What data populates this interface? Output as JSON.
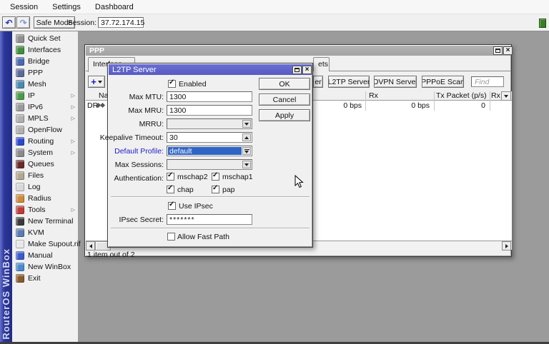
{
  "menubar": {
    "items": [
      "Session",
      "Settings",
      "Dashboard"
    ]
  },
  "toolbar": {
    "safe_mode_label": "Safe Mode",
    "session_label": "Session:",
    "session_value": "37.72.174.15"
  },
  "sidebar": {
    "brand": "RouterOS WinBox",
    "items": [
      {
        "slug": "quick-set",
        "label": "Quick Set",
        "color": "#8f8f8f",
        "arrow": false
      },
      {
        "slug": "interfaces",
        "label": "Interfaces",
        "color": "#3f8f3f",
        "arrow": false
      },
      {
        "slug": "bridge",
        "label": "Bridge",
        "color": "#4a6ab0",
        "arrow": false
      },
      {
        "slug": "ppp",
        "label": "PPP",
        "color": "#5a6a9a",
        "arrow": false
      },
      {
        "slug": "mesh",
        "label": "Mesh",
        "color": "#4a8ab0",
        "arrow": false
      },
      {
        "slug": "ip",
        "label": "IP",
        "color": "#4a9a4a",
        "arrow": true
      },
      {
        "slug": "ipv6",
        "label": "IPv6",
        "color": "#9a9a9a",
        "arrow": true
      },
      {
        "slug": "mpls",
        "label": "MPLS",
        "color": "#b0b0b0",
        "arrow": true
      },
      {
        "slug": "openflow",
        "label": "OpenFlow",
        "color": "#b0b0b0",
        "arrow": false
      },
      {
        "slug": "routing",
        "label": "Routing",
        "color": "#2a4ad0",
        "arrow": true
      },
      {
        "slug": "system",
        "label": "System",
        "color": "#8a8a8a",
        "arrow": true
      },
      {
        "slug": "queues",
        "label": "Queues",
        "color": "#6a2a2a",
        "arrow": false
      },
      {
        "slug": "files",
        "label": "Files",
        "color": "#b0a890",
        "arrow": false
      },
      {
        "slug": "log",
        "label": "Log",
        "color": "#d8d8d8",
        "arrow": false
      },
      {
        "slug": "radius",
        "label": "Radius",
        "color": "#d08a3a",
        "arrow": false
      },
      {
        "slug": "tools",
        "label": "Tools",
        "color": "#c03a3a",
        "arrow": true
      },
      {
        "slug": "new-terminal",
        "label": "New Terminal",
        "color": "#3a3a3a",
        "arrow": false
      },
      {
        "slug": "kvm",
        "label": "KVM",
        "color": "#5a7ab0",
        "arrow": false
      },
      {
        "slug": "make-supout-rif",
        "label": "Make Supout.rif",
        "color": "#e8e8e8",
        "arrow": false
      },
      {
        "slug": "manual",
        "label": "Manual",
        "color": "#3a5ad0",
        "arrow": false
      },
      {
        "slug": "new-winbox",
        "label": "New WinBox",
        "color": "#4a8ad0",
        "arrow": false
      },
      {
        "slug": "exit",
        "label": "Exit",
        "color": "#8a5a2a",
        "arrow": false
      }
    ]
  },
  "ppp": {
    "title": "PPP",
    "tab_interface": "Interface",
    "tab_right_partial": "ets",
    "button_partial": "er",
    "server_buttons": [
      "L2TP Server",
      "OVPN Server",
      "PPPoE Scan"
    ],
    "find_placeholder": "Find",
    "columns": {
      "name_partial": "Na",
      "rx": "Rx",
      "tx_packet": "Tx Packet (p/s)",
      "rx_p_partial": "Rx P"
    },
    "row": {
      "flags": "DR",
      "tx_value": "0 bps",
      "rx_value": "0 bps",
      "tx_packet_value": "0"
    },
    "status": "1 item out of 2"
  },
  "dialog": {
    "title": "L2TP Server",
    "enabled_label": "Enabled",
    "enabled_checked": true,
    "fields": {
      "max_mtu": {
        "label": "Max MTU:",
        "value": "1300"
      },
      "max_mru": {
        "label": "Max MRU:",
        "value": "1300"
      },
      "mrru": {
        "label": "MRRU:",
        "value": ""
      },
      "keepalive": {
        "label": "Keepalive Timeout:",
        "value": "30"
      },
      "default_profile": {
        "label": "Default Profile:",
        "value": "default"
      },
      "max_sessions": {
        "label": "Max Sessions:",
        "value": ""
      }
    },
    "auth": {
      "label": "Authentication:",
      "options": [
        {
          "label": "mschap2",
          "checked": true
        },
        {
          "label": "mschap1",
          "checked": true
        },
        {
          "label": "chap",
          "checked": true
        },
        {
          "label": "pap",
          "checked": true
        }
      ]
    },
    "use_ipsec_label": "Use IPsec",
    "use_ipsec_checked": true,
    "ipsec_secret": {
      "label": "IPsec Secret:",
      "value": "*******"
    },
    "allow_fast_path_label": "Allow Fast Path",
    "allow_fast_path_checked": false,
    "buttons": [
      "OK",
      "Cancel",
      "Apply"
    ]
  },
  "icons": {
    "undo": "↶",
    "redo": "↷",
    "close": "×",
    "check": "✓",
    "submenu": "▷"
  },
  "colors": {
    "titlebar_active": "#575ac4",
    "titlebar_inactive": "#a8a8a8",
    "selection": "#2e64c6",
    "label_blue": "#2020c8",
    "indicator_green": "#3a7d23",
    "sidebar_strip": "#2b3699",
    "desktop": "#9b9b9b"
  }
}
